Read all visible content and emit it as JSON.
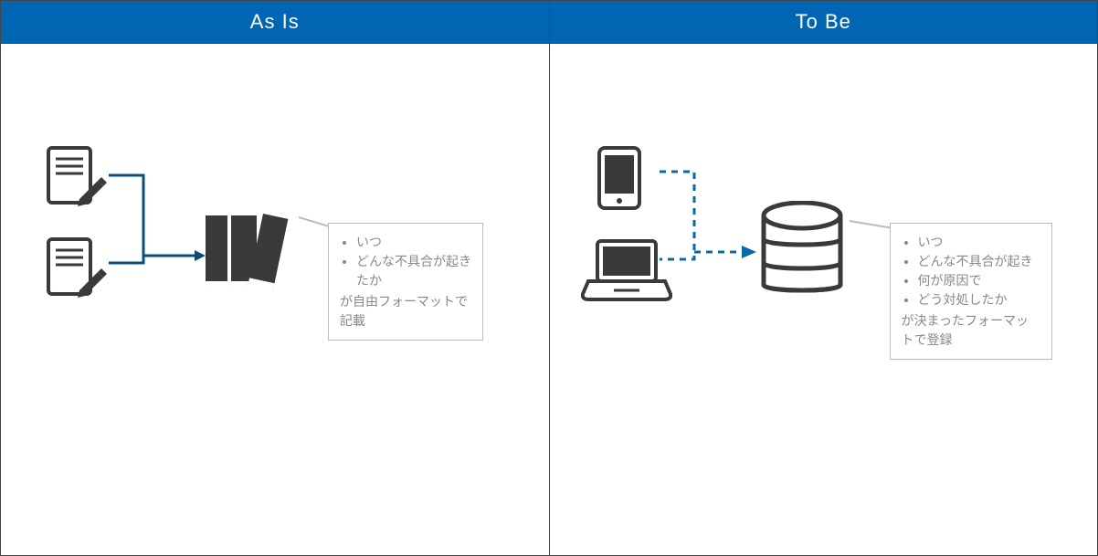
{
  "asIs": {
    "title": "As Is",
    "bullets": [
      "いつ",
      "どんな不具合が起きたか"
    ],
    "tail": "が自由フォーマットで記載"
  },
  "toBe": {
    "title": "To Be",
    "bullets": [
      "いつ",
      "どんな不具合が起き",
      "何が原因で",
      "どう対処したか"
    ],
    "tail": "が決まったフォーマットで登録"
  }
}
